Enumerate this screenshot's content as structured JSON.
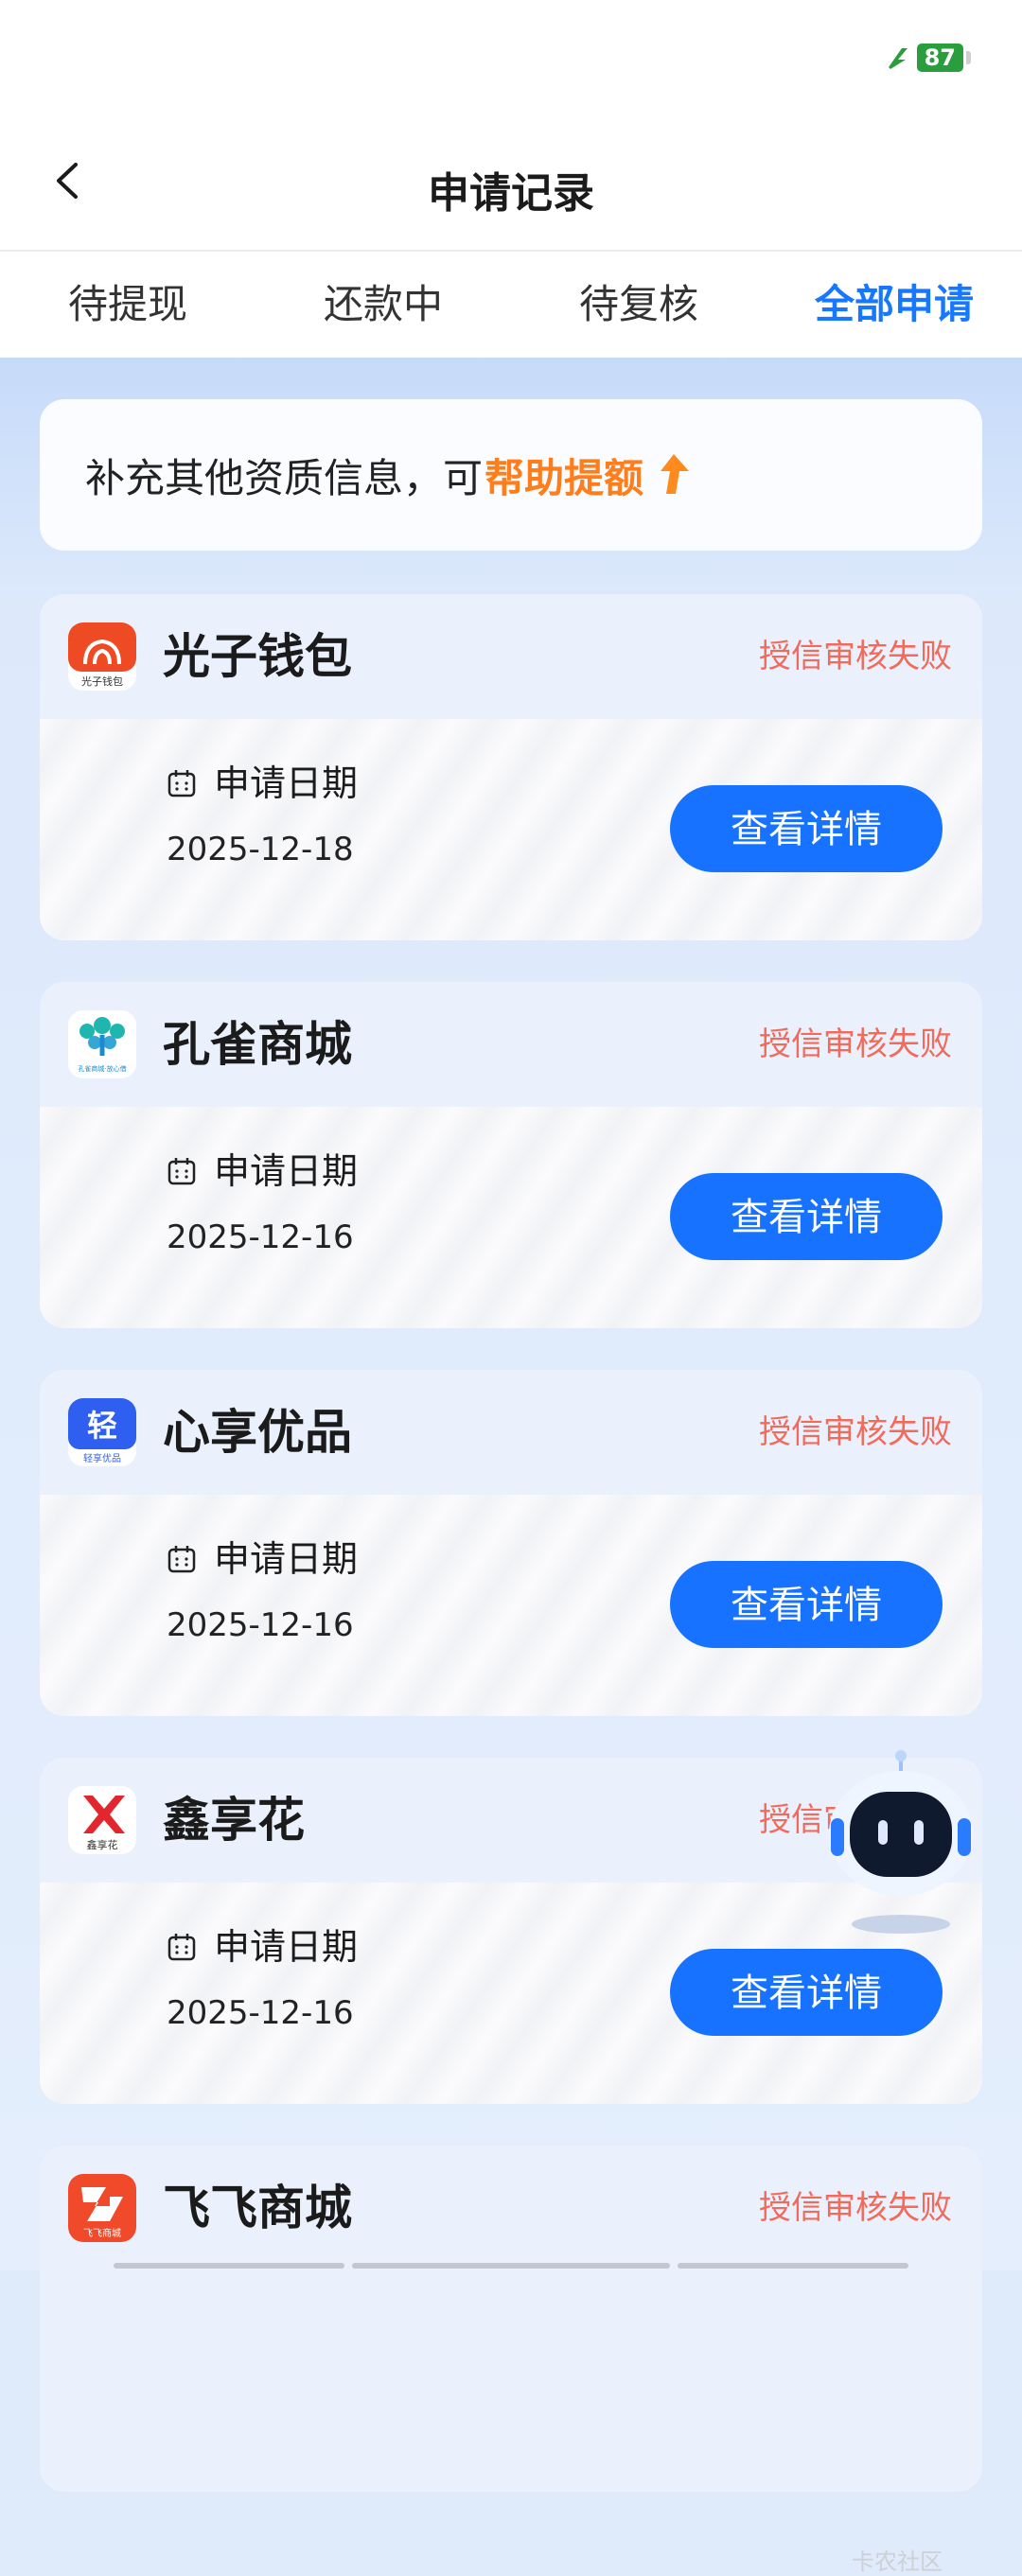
{
  "status_bar": {
    "battery_level": "87",
    "battery_color": "#2a9d3c"
  },
  "header": {
    "title": "申请记录",
    "back_icon": "chevron-left-icon"
  },
  "tabs": [
    {
      "label": "待提现",
      "active": false
    },
    {
      "label": "还款中",
      "active": false
    },
    {
      "label": "待复核",
      "active": false
    },
    {
      "label": "全部申请",
      "active": true
    }
  ],
  "tip": {
    "text": "补充其他资质信息，可",
    "highlight": "帮助提额",
    "highlight_color": "#ff7d1a",
    "icon": "arrow-up-icon"
  },
  "records": [
    {
      "name": "光子钱包",
      "status": "授信审核失败",
      "date_label": "申请日期",
      "date": "2025-12-18",
      "button": "查看详情",
      "logo_text": "光子钱包",
      "logo": "guangzi-logo"
    },
    {
      "name": "孔雀商城",
      "status": "授信审核失败",
      "date_label": "申请日期",
      "date": "2025-12-16",
      "button": "查看详情",
      "logo_text": "孔雀商城·放心借",
      "logo": "kongque-logo"
    },
    {
      "name": "心享优品",
      "status": "授信审核失败",
      "date_label": "申请日期",
      "date": "2025-12-16",
      "button": "查看详情",
      "logo_text": "轻",
      "logo_subtext": "轻享优品",
      "logo": "xinxiang-logo"
    },
    {
      "name": "鑫享花",
      "status": "授信审核失败",
      "date_label": "申请日期",
      "date": "2025-12-16",
      "button": "查看详情",
      "logo_text": "鑫享花",
      "logo": "xinxianghua-logo"
    },
    {
      "name": "飞飞商城",
      "status": "授信审核失败",
      "date_label": "",
      "date": "",
      "button": "",
      "logo_text": "飞飞商城",
      "logo": "feifei-logo"
    }
  ],
  "assistant": {
    "icon": "robot-assistant-icon"
  },
  "watermark": {
    "text": "卡农社区"
  },
  "colors": {
    "accent": "#1672ff",
    "status_fail": "#f26a5a",
    "active_tab": "#1677ff"
  }
}
